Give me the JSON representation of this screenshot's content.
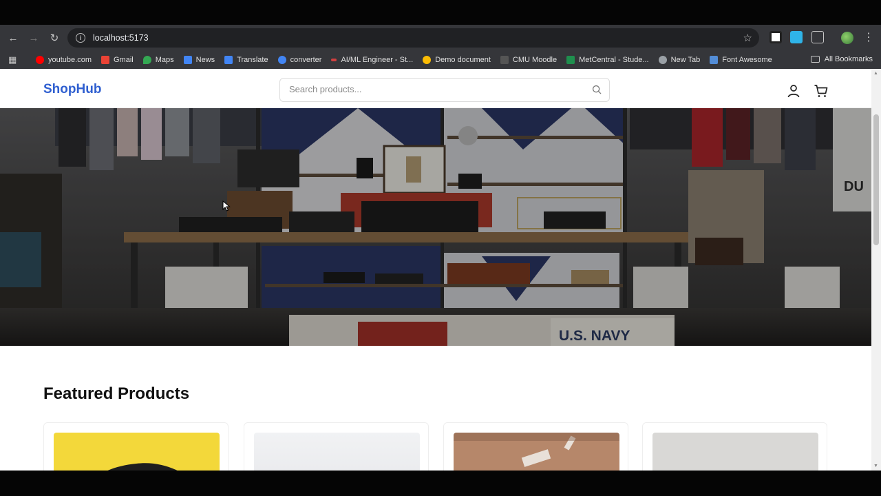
{
  "browser": {
    "url": "localhost:5173",
    "bookmarks": [
      {
        "label": "youtube.com",
        "color": "#ff0000"
      },
      {
        "label": "Gmail",
        "color": "#ea4335"
      },
      {
        "label": "Maps",
        "color": "#34a853"
      },
      {
        "label": "News",
        "color": "#4285f4"
      },
      {
        "label": "Translate",
        "color": "#4285f4"
      },
      {
        "label": "converter",
        "color": "#4285f4"
      },
      {
        "label": "AI/ML Engineer - St...",
        "color": "#d04040"
      },
      {
        "label": "Demo document",
        "color": "#fbbc04"
      },
      {
        "label": "CMU Moodle",
        "color": "#555555"
      },
      {
        "label": "MetCentral - Stude...",
        "color": "#1f8f4e"
      },
      {
        "label": "New Tab",
        "color": "#9aa0a6"
      },
      {
        "label": "Font Awesome",
        "color": "#538dd7"
      }
    ],
    "all_bookmarks": "All Bookmarks"
  },
  "site": {
    "logo": "ShopHub",
    "brand_color": "#2f5fd0",
    "search_placeholder": "Search products...",
    "hero_text": "U.S. NAVY",
    "section_title": "Featured Products"
  }
}
